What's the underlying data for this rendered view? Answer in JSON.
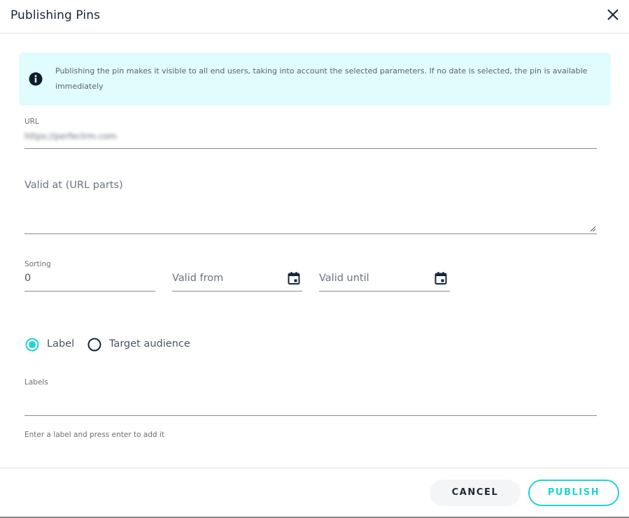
{
  "dialog": {
    "title": "Publishing Pins",
    "close_icon": "close-icon"
  },
  "info": {
    "icon": "info-icon",
    "text": "Publishing the pin makes it visible to all end users, taking into account the selected parameters. If no date is selected, the pin is available immediately",
    "background": "#e0fcfd"
  },
  "form": {
    "url": {
      "label": "URL",
      "value": "https://perfectrm.com"
    },
    "valid_at": {
      "placeholder": "Valid at (URL parts)",
      "value": ""
    },
    "sorting": {
      "label": "Sorting",
      "value": "0"
    },
    "valid_from": {
      "placeholder": "Valid from",
      "icon": "calendar-icon"
    },
    "valid_until": {
      "placeholder": "Valid until",
      "icon": "calendar-icon"
    },
    "mode": {
      "options": [
        {
          "label": "Label",
          "selected": true
        },
        {
          "label": "Target audience",
          "selected": false
        }
      ]
    },
    "labels": {
      "label": "Labels",
      "value": "",
      "helper": "Enter a label and press enter to add it"
    }
  },
  "footer": {
    "cancel_label": "CANCEL",
    "publish_label": "PUBLISH"
  },
  "colors": {
    "accent": "#1fd3d8",
    "text_dark": "#15263a"
  }
}
